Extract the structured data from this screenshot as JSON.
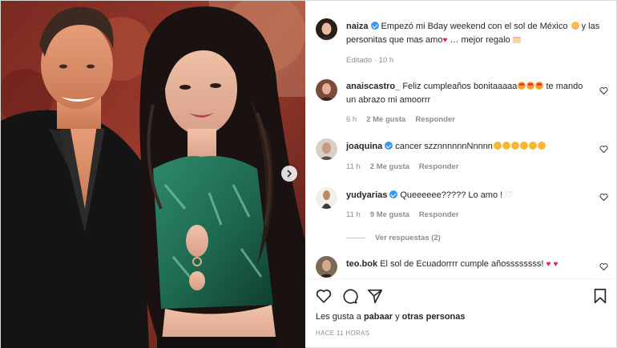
{
  "post": {
    "author": "naiza",
    "caption_a": "Empezó mi Bday weekend con el sol de México",
    "caption_b": "y las personitas que mas amo",
    "caption_c": "… mejor regalo",
    "edited": "Editado · 10 h"
  },
  "comments": [
    {
      "user": "anaiscastro_",
      "text_a": "Feliz cumpleaños bonitaaaaa",
      "text_b": "te mando un abrazo mi amoorrr",
      "time": "6 h",
      "likes": "2 Me gusta",
      "reply": "Responder"
    },
    {
      "user": "joaquina",
      "text_a": "cancer szznnnnnnNnnnn",
      "time": "11 h",
      "likes": "2 Me gusta",
      "reply": "Responder"
    },
    {
      "user": "yudyarias",
      "text_a": "Queeeeee????? Lo amo !",
      "time": "11 h",
      "likes": "9 Me gusta",
      "reply": "Responder",
      "view_replies": "Ver respuestas (2)"
    },
    {
      "user": "teo.bok",
      "text_a": "El sol de Ecuadorrrr cumple añossssssss!"
    }
  ],
  "likes_line": {
    "prefix": "Les gusta a",
    "user": "pabaar",
    "middle": "y",
    "others": "otras personas"
  },
  "timestamp": "HACE 11 HORAS",
  "icons": [
    "heart-icon",
    "comment-icon",
    "share-icon",
    "bookmark-icon",
    "chevron-right-icon",
    "verified-icon"
  ],
  "colors": {
    "verified": "#3897f0",
    "heart": "#e0245e",
    "meta": "#8e8e8e"
  }
}
